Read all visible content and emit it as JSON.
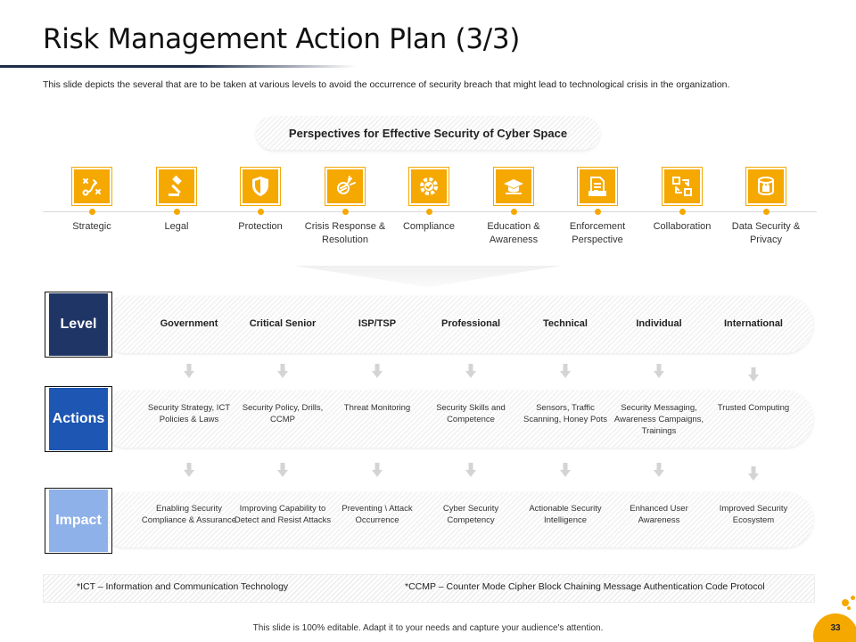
{
  "title": "Risk Management Action Plan (3/3)",
  "description": "This slide depicts the several that are to be taken at various levels to avoid the occurrence of security breach that might lead to technological crisis in the organization.",
  "perspectives_title": "Perspectives for Effective Security of Cyber Space",
  "perspectives": [
    {
      "label": "Strategic",
      "icon": "strategy-icon"
    },
    {
      "label": "Legal",
      "icon": "gavel-icon"
    },
    {
      "label": "Protection",
      "icon": "shield-icon"
    },
    {
      "label": "Crisis Response & Resolution",
      "icon": "crisis-icon"
    },
    {
      "label": "Compliance",
      "icon": "gear-check-icon"
    },
    {
      "label": "Education & Awareness",
      "icon": "graduation-cap-icon"
    },
    {
      "label": "Enforcement Perspective",
      "icon": "document-icon"
    },
    {
      "label": "Collaboration",
      "icon": "collaboration-icon"
    },
    {
      "label": "Data Security & Privacy",
      "icon": "data-lock-icon"
    }
  ],
  "rows": {
    "level": {
      "label": "Level",
      "items": [
        "Government",
        "Critical Senior",
        "ISP/TSP",
        "Professional",
        "Technical",
        "Individual",
        "International"
      ]
    },
    "actions": {
      "label": "Actions",
      "items": [
        "Security Strategy, ICT Policies & Laws",
        "Security Policy, Drills, CCMP",
        "Threat Monitoring",
        "Security Skills and Competence",
        "Sensors, Traffic Scanning, Honey Pots",
        "Security Messaging, Awareness Campaigns, Trainings",
        "Trusted Computing"
      ]
    },
    "impact": {
      "label": "Impact",
      "items": [
        "Enabling Security Compliance & Assurance",
        "Improving Capability to Detect and Resist Attacks",
        "Preventing \\ Attack Occurrence",
        "Cyber Security Competency",
        "Actionable Security Intelligence",
        "Enhanced User Awareness",
        "Improved Security Ecosystem"
      ]
    }
  },
  "footnotes": {
    "ict": "*ICT – Information and Communication Technology",
    "ccmp": "*CCMP – Counter Mode Cipher Block Chaining Message Authentication Code Protocol"
  },
  "bottom_note": "This slide is 100% editable. Adapt it to your needs and capture your audience's attention.",
  "page_number": "33",
  "colors": {
    "accent": "#f5a800",
    "level_box": "#1f3566",
    "actions_box": "#1d56b3",
    "impact_box": "#8fb1ea"
  }
}
